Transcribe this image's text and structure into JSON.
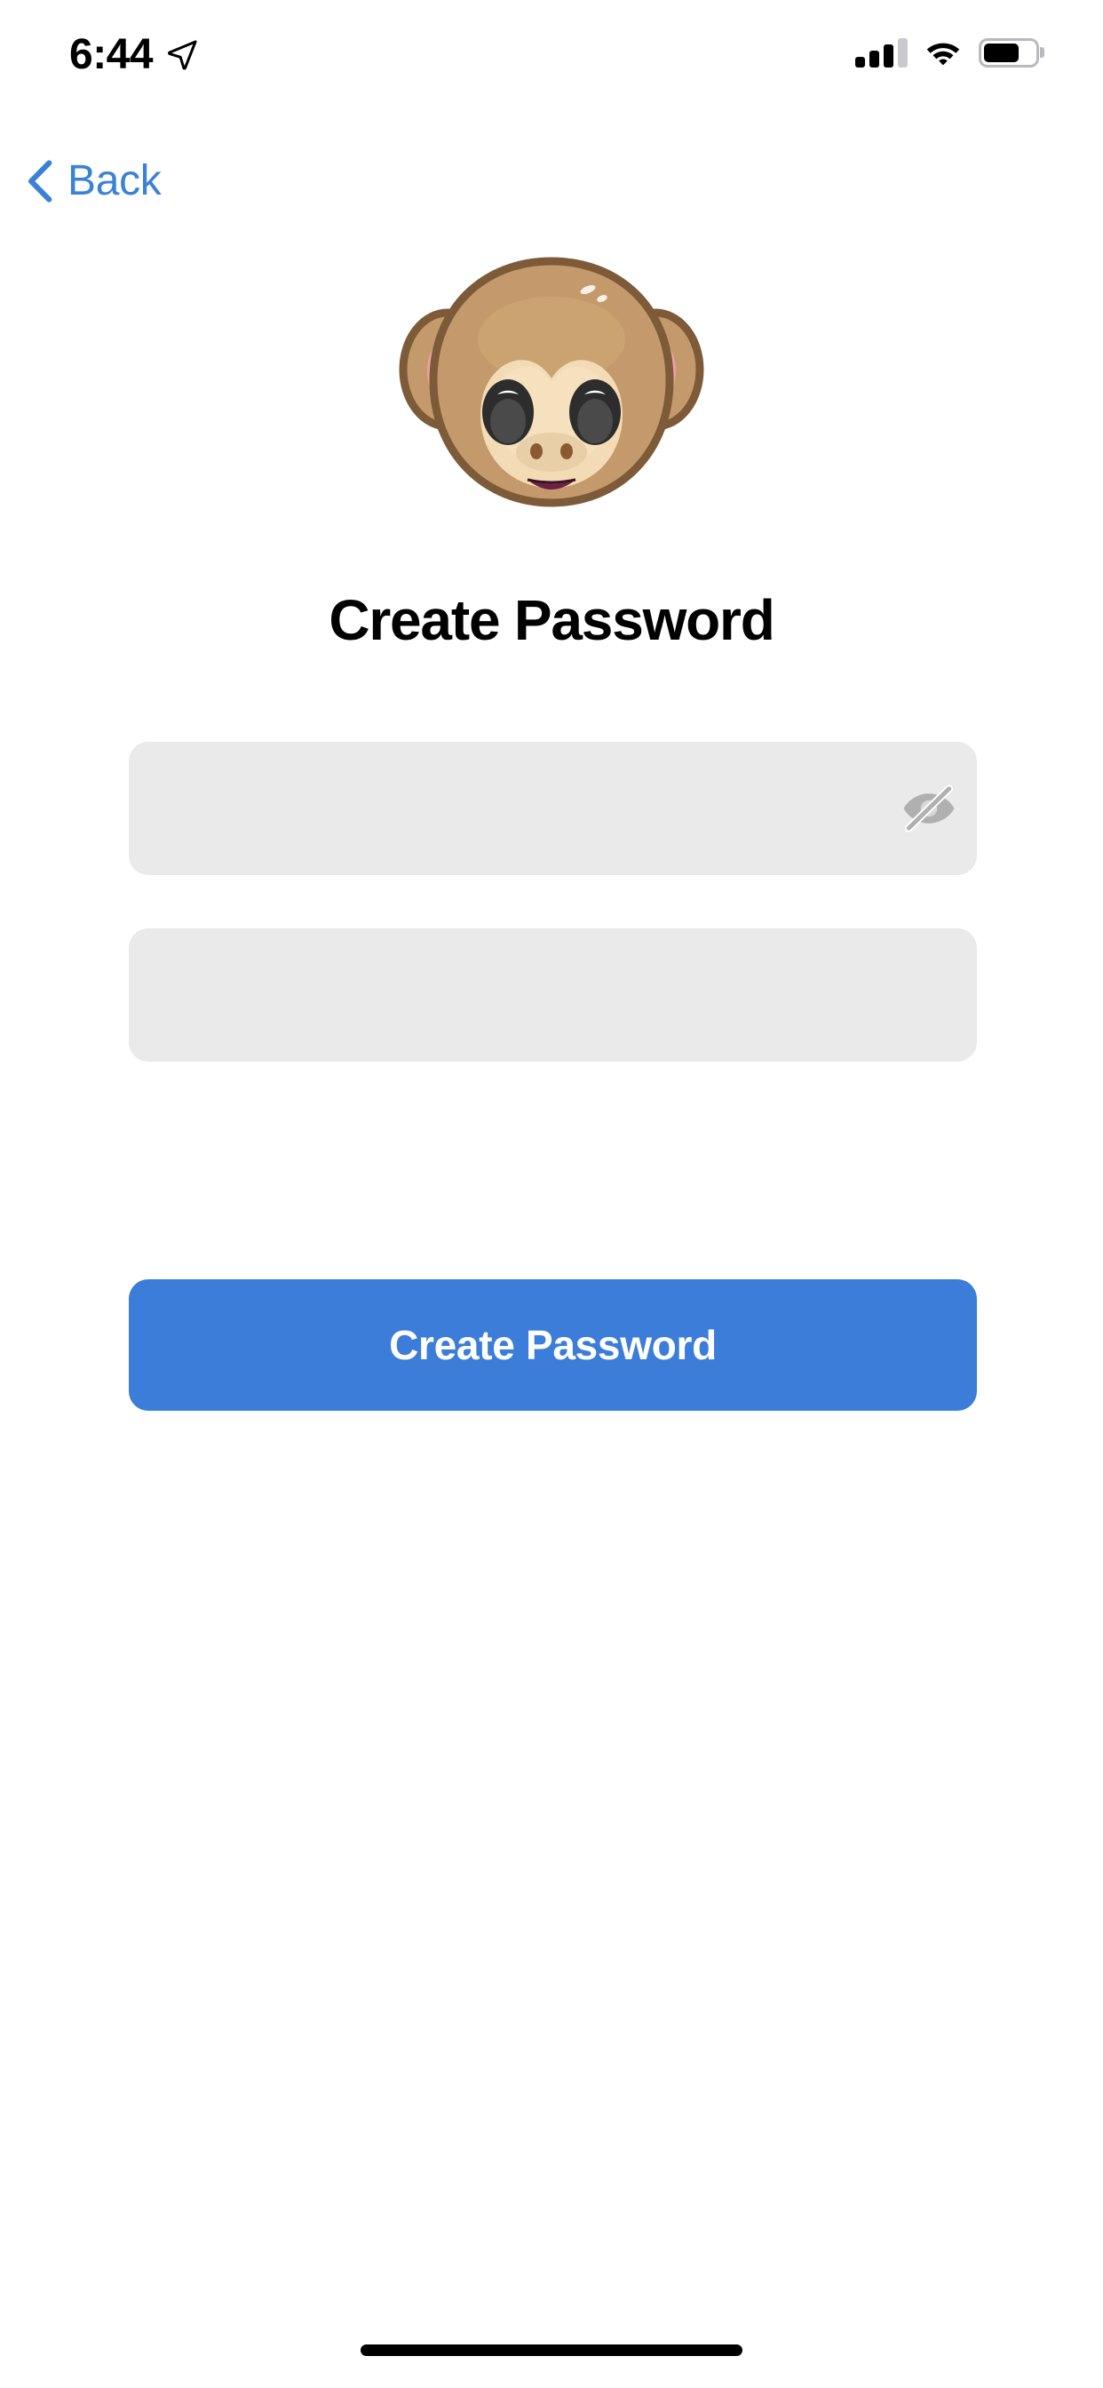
{
  "status_bar": {
    "time": "6:44",
    "location_icon": "location-arrow-icon",
    "cellular_icon": "cellular-signal-icon",
    "cellular_bars_filled": 3,
    "cellular_bars_total": 4,
    "wifi_icon": "wifi-icon",
    "battery_icon": "battery-icon",
    "battery_level_percent": 70
  },
  "navigation": {
    "back_label": "Back",
    "back_icon": "chevron-left-icon",
    "back_color": "#3B82D6"
  },
  "hero": {
    "emoji_name": "monkey-face-emoji",
    "emoji_char": "🐵"
  },
  "main": {
    "title": "Create Password",
    "fields": [
      {
        "name": "password-field",
        "value": "",
        "placeholder": "",
        "has_visibility_toggle": true,
        "toggle_icon": "eye-off-icon",
        "toggle_state": "hidden"
      },
      {
        "name": "confirm-password-field",
        "value": "",
        "placeholder": "",
        "has_visibility_toggle": false
      }
    ],
    "submit_label": "Create Password"
  },
  "colors": {
    "accent_blue": "#3B7DD8",
    "link_blue": "#3B82D6",
    "field_background": "#EAEAEA",
    "page_background": "#FFFFFF",
    "text_primary": "#000000",
    "icon_gray": "#B0B0B0"
  },
  "system": {
    "home_indicator": "home-indicator"
  }
}
